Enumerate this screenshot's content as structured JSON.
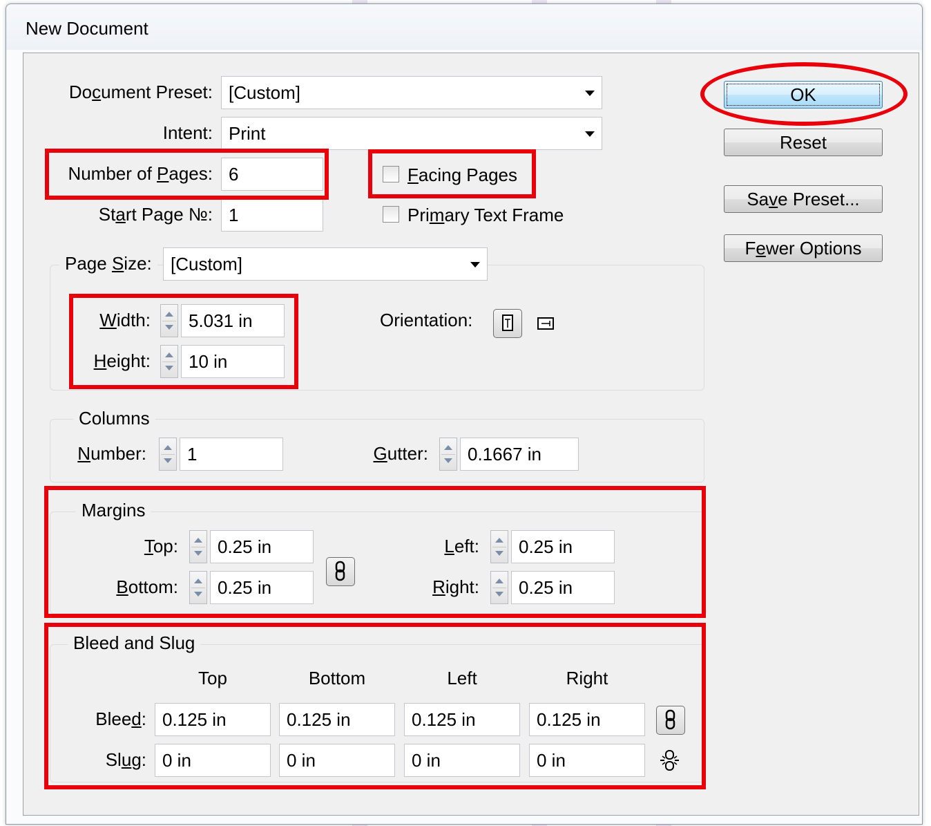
{
  "window": {
    "title": "New Document"
  },
  "buttons": {
    "ok": "OK",
    "reset": "Reset",
    "save_preset": "Save Preset...",
    "fewer_options": "Fewer Options"
  },
  "document_preset": {
    "label": "Document Preset:",
    "value": "[Custom]"
  },
  "intent": {
    "label": "Intent:",
    "value": "Print"
  },
  "pages": {
    "number_label": "Number of Pages:",
    "number_value": "6",
    "start_label": "Start Page №:",
    "start_value": "1",
    "facing_label": "Facing Pages",
    "facing_checked": false,
    "primary_label": "Primary Text Frame",
    "primary_checked": false
  },
  "page_size": {
    "label": "Page Size:",
    "value": "[Custom]",
    "width_label": "Width:",
    "width_value": "5.031 in",
    "height_label": "Height:",
    "height_value": "10 in",
    "orientation_label": "Orientation:",
    "orientation_selected": "portrait"
  },
  "columns": {
    "legend": "Columns",
    "number_label": "Number:",
    "number_value": "1",
    "gutter_label": "Gutter:",
    "gutter_value": "0.1667 in"
  },
  "margins": {
    "legend": "Margins",
    "top_label": "Top:",
    "top_value": "0.25 in",
    "bottom_label": "Bottom:",
    "bottom_value": "0.25 in",
    "left_label": "Left:",
    "left_value": "0.25 in",
    "right_label": "Right:",
    "right_value": "0.25 in",
    "linked": true
  },
  "bleed_slug": {
    "legend": "Bleed and Slug",
    "headers": [
      "Top",
      "Bottom",
      "Left",
      "Right"
    ],
    "bleed_label": "Bleed:",
    "bleed_values": [
      "0.125 in",
      "0.125 in",
      "0.125 in",
      "0.125 in"
    ],
    "slug_label": "Slug:",
    "slug_values": [
      "0 in",
      "0 in",
      "0 in",
      "0 in"
    ],
    "bleed_linked": true,
    "slug_linked": false
  },
  "annotation_color": "#e8000b"
}
